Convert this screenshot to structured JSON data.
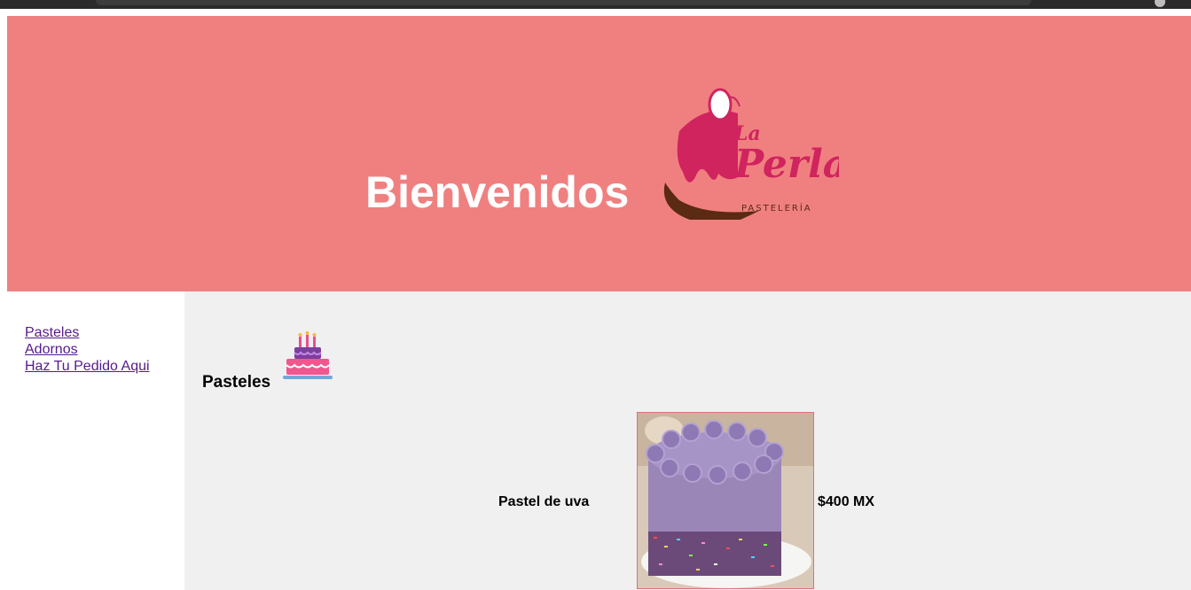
{
  "header": {
    "welcome": "Bienvenidos",
    "logo": {
      "script_text": "La Perla",
      "subtitle": "PASTELERÍA",
      "colors": {
        "primary": "#d0245e",
        "shadow": "#5a2a12"
      }
    },
    "background_color": "#f08080"
  },
  "nav": {
    "items": [
      {
        "label": "Pasteles"
      },
      {
        "label": "Adornos"
      },
      {
        "label": "Haz Tu Pedido Aqui"
      }
    ]
  },
  "main": {
    "section_title": "Pasteles",
    "section_icon": "birthday-cake-icon",
    "products": [
      {
        "name": "Pastel de uva",
        "price": "$400 MX",
        "image": "purple-frosted-cake-photo"
      }
    ]
  }
}
